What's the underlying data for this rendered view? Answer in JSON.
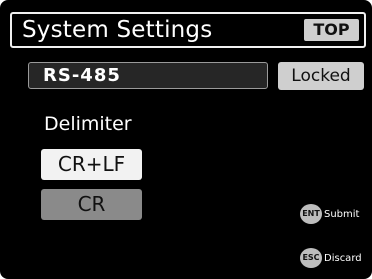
{
  "header": {
    "title": "System Settings",
    "top_button": "TOP"
  },
  "protocol": {
    "value": "RS-485",
    "status": "Locked"
  },
  "delimiter": {
    "label": "Delimiter",
    "options": [
      {
        "label": "CR+LF",
        "selected": true
      },
      {
        "label": "CR",
        "selected": false
      }
    ]
  },
  "hints": {
    "submit": {
      "key": "ENT",
      "label": "Submit"
    },
    "discard": {
      "key": "ESC",
      "label": "Discard"
    }
  },
  "colors": {
    "background": "#000000",
    "selected_option": "#f2f2f2",
    "unselected_option": "#8a8a8a",
    "button_gray": "#cfcfcf"
  }
}
